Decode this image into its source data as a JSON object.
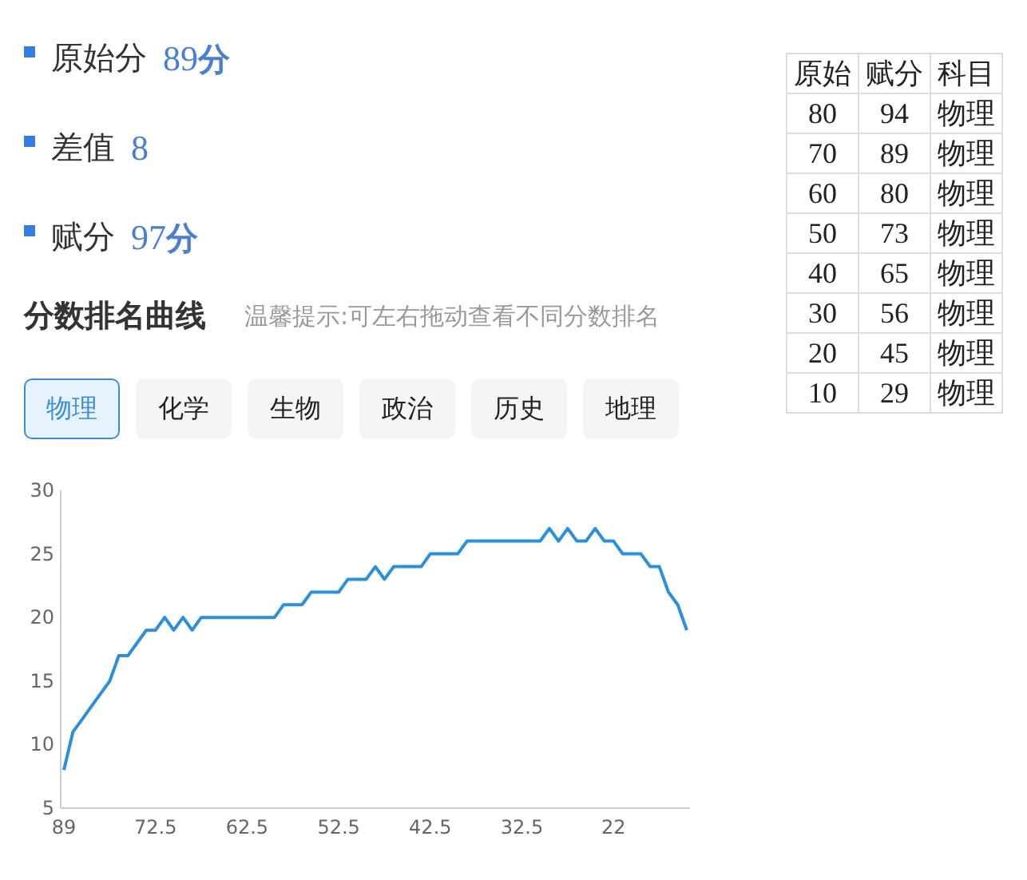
{
  "score_items": [
    {
      "label": "原始分",
      "value": "89",
      "unit": "分"
    },
    {
      "label": "差值",
      "value": "8"
    },
    {
      "label": "赋分",
      "value": "97",
      "unit": "分"
    }
  ],
  "section": {
    "title": "分数排名曲线",
    "hint": "温馨提示:可左右拖动查看不同分数排名"
  },
  "subject_tabs": [
    {
      "label": "物理",
      "selected": true
    },
    {
      "label": "化学",
      "selected": false
    },
    {
      "label": "生物",
      "selected": false
    },
    {
      "label": "政治",
      "selected": false
    },
    {
      "label": "历史",
      "selected": false
    },
    {
      "label": "地理",
      "selected": false
    }
  ],
  "chart": {
    "chart_data": {
      "type": "line",
      "categories": [
        "89",
        null,
        null,
        null,
        null,
        null,
        null,
        null,
        null,
        null,
        "72.5",
        null,
        null,
        null,
        null,
        null,
        null,
        null,
        null,
        null,
        "62.5",
        null,
        null,
        null,
        null,
        null,
        null,
        null,
        null,
        null,
        "52.5",
        null,
        null,
        null,
        null,
        null,
        null,
        null,
        null,
        null,
        "42.5",
        null,
        null,
        null,
        null,
        null,
        null,
        null,
        null,
        null,
        "32.5",
        null,
        null,
        null,
        null,
        null,
        null,
        null,
        null,
        null,
        "22",
        null,
        null,
        null,
        null,
        null,
        null,
        null,
        null
      ],
      "series": [
        {
          "color": "#2b8fdb",
          "values": [
            8,
            11,
            12,
            13,
            14,
            15,
            17,
            17,
            18,
            19,
            19,
            20,
            19,
            20,
            19,
            20,
            20,
            20,
            20,
            20,
            20,
            20,
            20,
            20,
            21,
            21,
            21,
            22,
            22,
            22,
            22,
            23,
            23,
            23,
            24,
            23,
            24,
            24,
            24,
            24,
            25,
            25,
            25,
            25,
            26,
            26,
            26,
            26,
            26,
            26,
            26,
            26,
            26,
            27,
            26,
            27,
            26,
            26,
            27,
            26,
            26,
            25,
            25,
            25,
            24,
            24,
            22,
            21,
            19
          ]
        }
      ],
      "ylim": [
        5,
        30
      ],
      "yticks": [
        5,
        10,
        15,
        20,
        25,
        30
      ]
    }
  },
  "conversion_table": {
    "columns": [
      "原始",
      "赋分",
      "科目"
    ],
    "rows": [
      [
        "80",
        "94",
        "物理"
      ],
      [
        "70",
        "89",
        "物理"
      ],
      [
        "60",
        "80",
        "物理"
      ],
      [
        "50",
        "73",
        "物理"
      ],
      [
        "40",
        "65",
        "物理"
      ],
      [
        "30",
        "56",
        "物理"
      ],
      [
        "20",
        "45",
        "物理"
      ],
      [
        "10",
        "29",
        "物理"
      ]
    ]
  }
}
